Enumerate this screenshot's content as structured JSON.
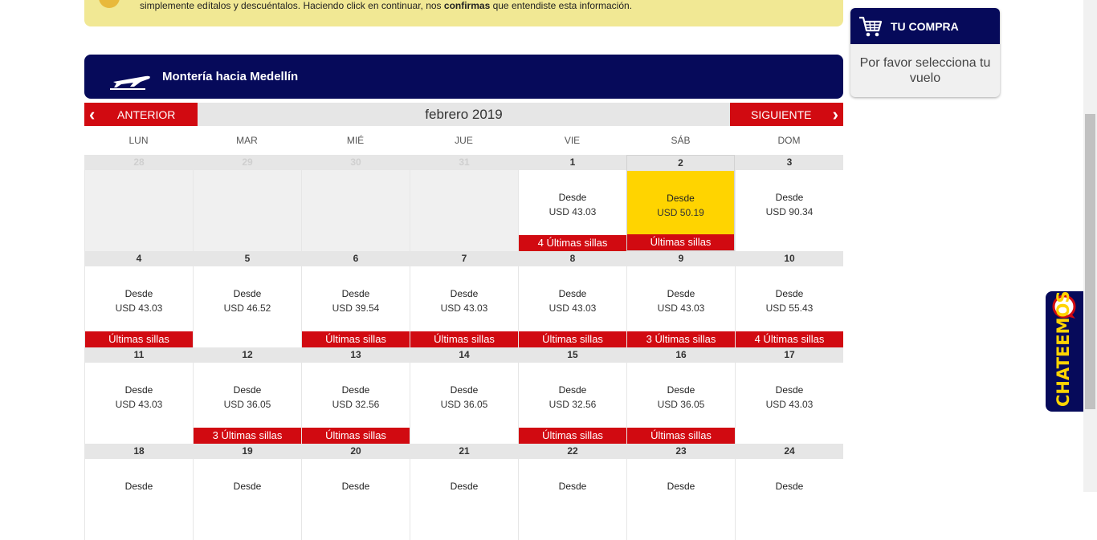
{
  "notice": {
    "text_before": "simplemente edítalos y descuéntalos. Haciendo click en continuar, nos ",
    "text_bold": "confirmas",
    "text_after": " que entendiste esta información."
  },
  "route": {
    "title": "Montería hacia Medellín",
    "icon": "plane-icon"
  },
  "calendar": {
    "prev_label": "ANTERIOR",
    "next_label": "SIGUIENTE",
    "month": "febrero 2019",
    "weekdays": [
      "LUN",
      "MAR",
      "MIÉ",
      "JUE",
      "VIE",
      "SÁB",
      "DOM"
    ],
    "from_label": "Desde",
    "days": [
      {
        "day": "28",
        "outside": true
      },
      {
        "day": "29",
        "outside": true
      },
      {
        "day": "30",
        "outside": true
      },
      {
        "day": "31",
        "outside": true
      },
      {
        "day": "1",
        "price": "USD 43.03",
        "seats": "4 Últimas sillas"
      },
      {
        "day": "2",
        "price": "USD 50.19",
        "seats": "Últimas sillas",
        "selected": true
      },
      {
        "day": "3",
        "price": "USD 90.34"
      },
      {
        "day": "4",
        "price": "USD 43.03",
        "seats": "Últimas sillas"
      },
      {
        "day": "5",
        "price": "USD 46.52"
      },
      {
        "day": "6",
        "price": "USD 39.54",
        "seats": "Últimas sillas"
      },
      {
        "day": "7",
        "price": "USD 43.03",
        "seats": "Últimas sillas"
      },
      {
        "day": "8",
        "price": "USD 43.03",
        "seats": "Últimas sillas"
      },
      {
        "day": "9",
        "price": "USD 43.03",
        "seats": "3 Últimas sillas"
      },
      {
        "day": "10",
        "price": "USD 55.43",
        "seats": "4 Últimas sillas"
      },
      {
        "day": "11",
        "price": "USD 43.03"
      },
      {
        "day": "12",
        "price": "USD 36.05",
        "seats": "3 Últimas sillas"
      },
      {
        "day": "13",
        "price": "USD 32.56",
        "seats": "Últimas sillas"
      },
      {
        "day": "14",
        "price": "USD 36.05"
      },
      {
        "day": "15",
        "price": "USD 32.56",
        "seats": "Últimas sillas"
      },
      {
        "day": "16",
        "price": "USD 36.05",
        "seats": "Últimas sillas"
      },
      {
        "day": "17",
        "price": "USD 43.03"
      },
      {
        "day": "18"
      },
      {
        "day": "19"
      },
      {
        "day": "20"
      },
      {
        "day": "21"
      },
      {
        "day": "22"
      },
      {
        "day": "23"
      },
      {
        "day": "24"
      }
    ]
  },
  "purchase": {
    "title": "TU COMPRA",
    "message": "Por favor selecciona tu vuelo",
    "icon": "cart-icon"
  },
  "chat": {
    "label": "CHATEEMOS",
    "icon": "chat-bubble-icon"
  },
  "colors": {
    "navy": "#060a5a",
    "red": "#d10a11",
    "selected": "#ffd400",
    "notice": "#f1e894"
  }
}
